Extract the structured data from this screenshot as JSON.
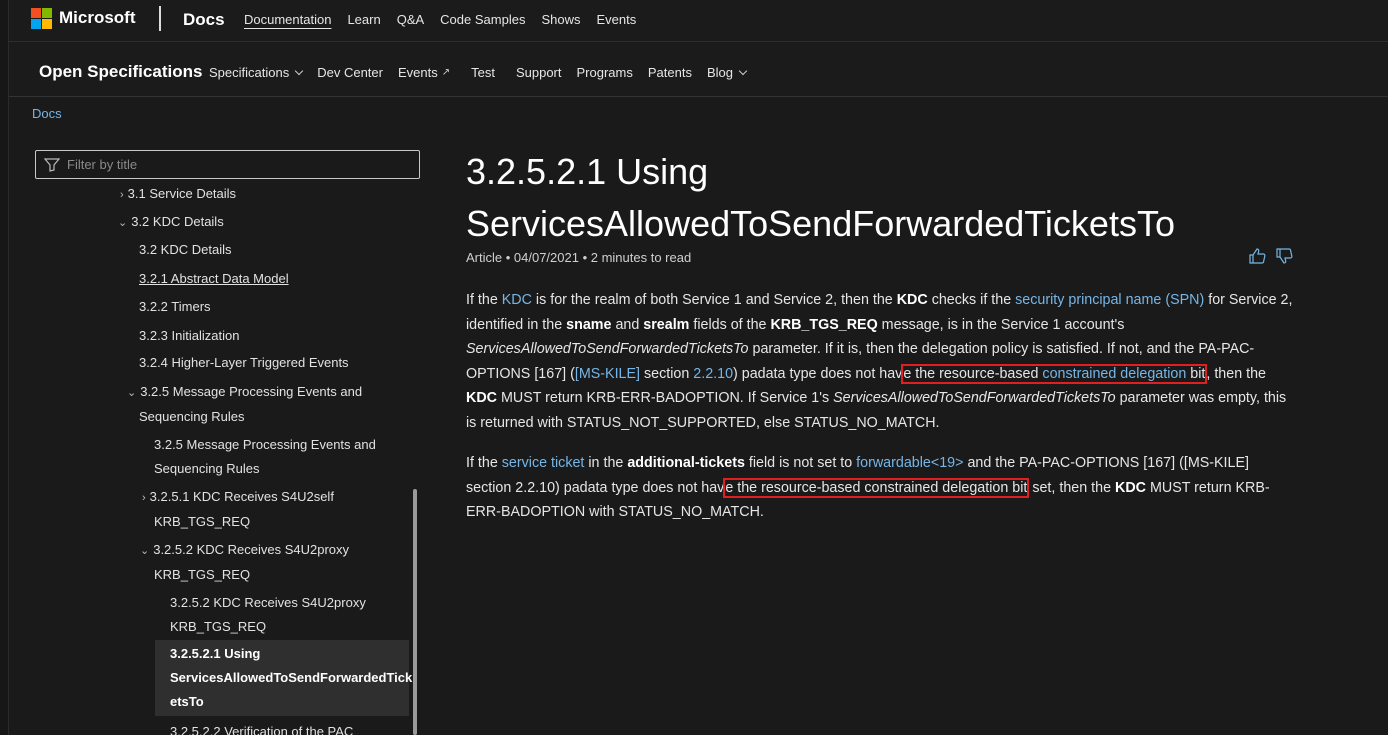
{
  "header": {
    "brand": "Microsoft",
    "docs": "Docs",
    "nav": [
      "Documentation",
      "Learn",
      "Q&A",
      "Code Samples",
      "Shows",
      "Events"
    ]
  },
  "subheader": {
    "title": "Open Specifications",
    "nav": {
      "specifications": "Specifications",
      "dev_center": "Dev Center",
      "events": "Events",
      "test": "Test",
      "support": "Support",
      "programs": "Programs",
      "patents": "Patents",
      "blog": "Blog"
    }
  },
  "breadcrumb": "Docs",
  "sidebar": {
    "filter_placeholder": "Filter by title",
    "items": [
      {
        "label": "3.1 Service Details",
        "chevron": "›"
      },
      {
        "label": "3.2 KDC Details",
        "chevron": "⌄"
      },
      {
        "label": "3.2 KDC Details"
      },
      {
        "label": "3.2.1 Abstract Data Model"
      },
      {
        "label": "3.2.2 Timers"
      },
      {
        "label": "3.2.3 Initialization"
      },
      {
        "label": "3.2.4 Higher-Layer Triggered Events"
      },
      {
        "label": "3.2.5 Message Processing Events and",
        "label2": "Sequencing Rules",
        "chevron": "⌄"
      },
      {
        "label": "3.2.5 Message Processing Events and",
        "label2": "Sequencing Rules"
      },
      {
        "label": "3.2.5.1 KDC Receives S4U2self",
        "label2": "KRB_TGS_REQ",
        "chevron": "›"
      },
      {
        "label": "3.2.5.2 KDC Receives S4U2proxy",
        "label2": "KRB_TGS_REQ",
        "chevron": "⌄"
      },
      {
        "label": "3.2.5.2 KDC Receives S4U2proxy",
        "label2": "KRB_TGS_REQ"
      },
      {
        "label": "3.2.5.2.1 Using",
        "label2": "ServicesAllowedToSendForwardedTick",
        "label3": "etsTo"
      },
      {
        "label": "3.2.5.2.2 Verification of the PAC"
      }
    ]
  },
  "article": {
    "title": "3.2.5.2.1 Using ServicesAllowedToSendForwardedTicketsTo",
    "meta": "Article • 04/07/2021 • 2 minutes to read",
    "p1": {
      "t1": "If the ",
      "kdc_link": "KDC",
      "t2": " is for the realm of both Service 1 and Service 2, then the ",
      "kdc_bold": "KDC",
      "t3": " checks if the ",
      "spn_link": "security principal name (SPN)",
      "t4": " for Service 2, identified in the ",
      "sname": "sname",
      "t5": " and ",
      "srealm": "srealm",
      "t6": " fields of the ",
      "krb": "KRB_TGS_REQ",
      "t7": " message, is in the Service 1 account's ",
      "param": "ServicesAllowedToSendForwardedTicketsTo",
      "t8": " parameter. If it is, then the delegation policy is satisfied. If not, and the PA-PAC-OPTIONS [167] (",
      "mskile_link": "[MS-KILE]",
      "t9": " section ",
      "section_link": "2.2.10",
      "t10": ") padata type does not hav",
      "hl_a": "e the resource-based ",
      "cd_link": "constrained delegation",
      "hl_b": " bit",
      "t11": ", then the ",
      "kdc_bold2": "KDC",
      "t12": " MUST return KRB-ERR-BADOPTION. If Service 1's ",
      "param2": "ServicesAllowedToSendForwardedTicketsTo",
      "t13": " parameter was empty, this is returned with STATUS_NOT_SUPPORTED, else STATUS_NO_MATCH."
    },
    "p2": {
      "t1": "If the ",
      "st_link": "service ticket",
      "t2": " in the ",
      "at": "additional-tickets",
      "t3": " field is not set to ",
      "fw_link": "forwardable<19>",
      "t4": " and the PA-PAC-OPTIONS [167] ([MS-KILE] section 2.2.10) padata type does not hav",
      "hl": "e the resource-based constrained delegation bit",
      "t5": " set, then the ",
      "kdc": "KDC",
      "t6": " MUST return KRB-ERR-BADOPTION with STATUS_NO_MATCH."
    }
  },
  "colors": {
    "link": "#75b6e7",
    "highlight_box": "#e02020",
    "background": "#1a1a1a"
  }
}
